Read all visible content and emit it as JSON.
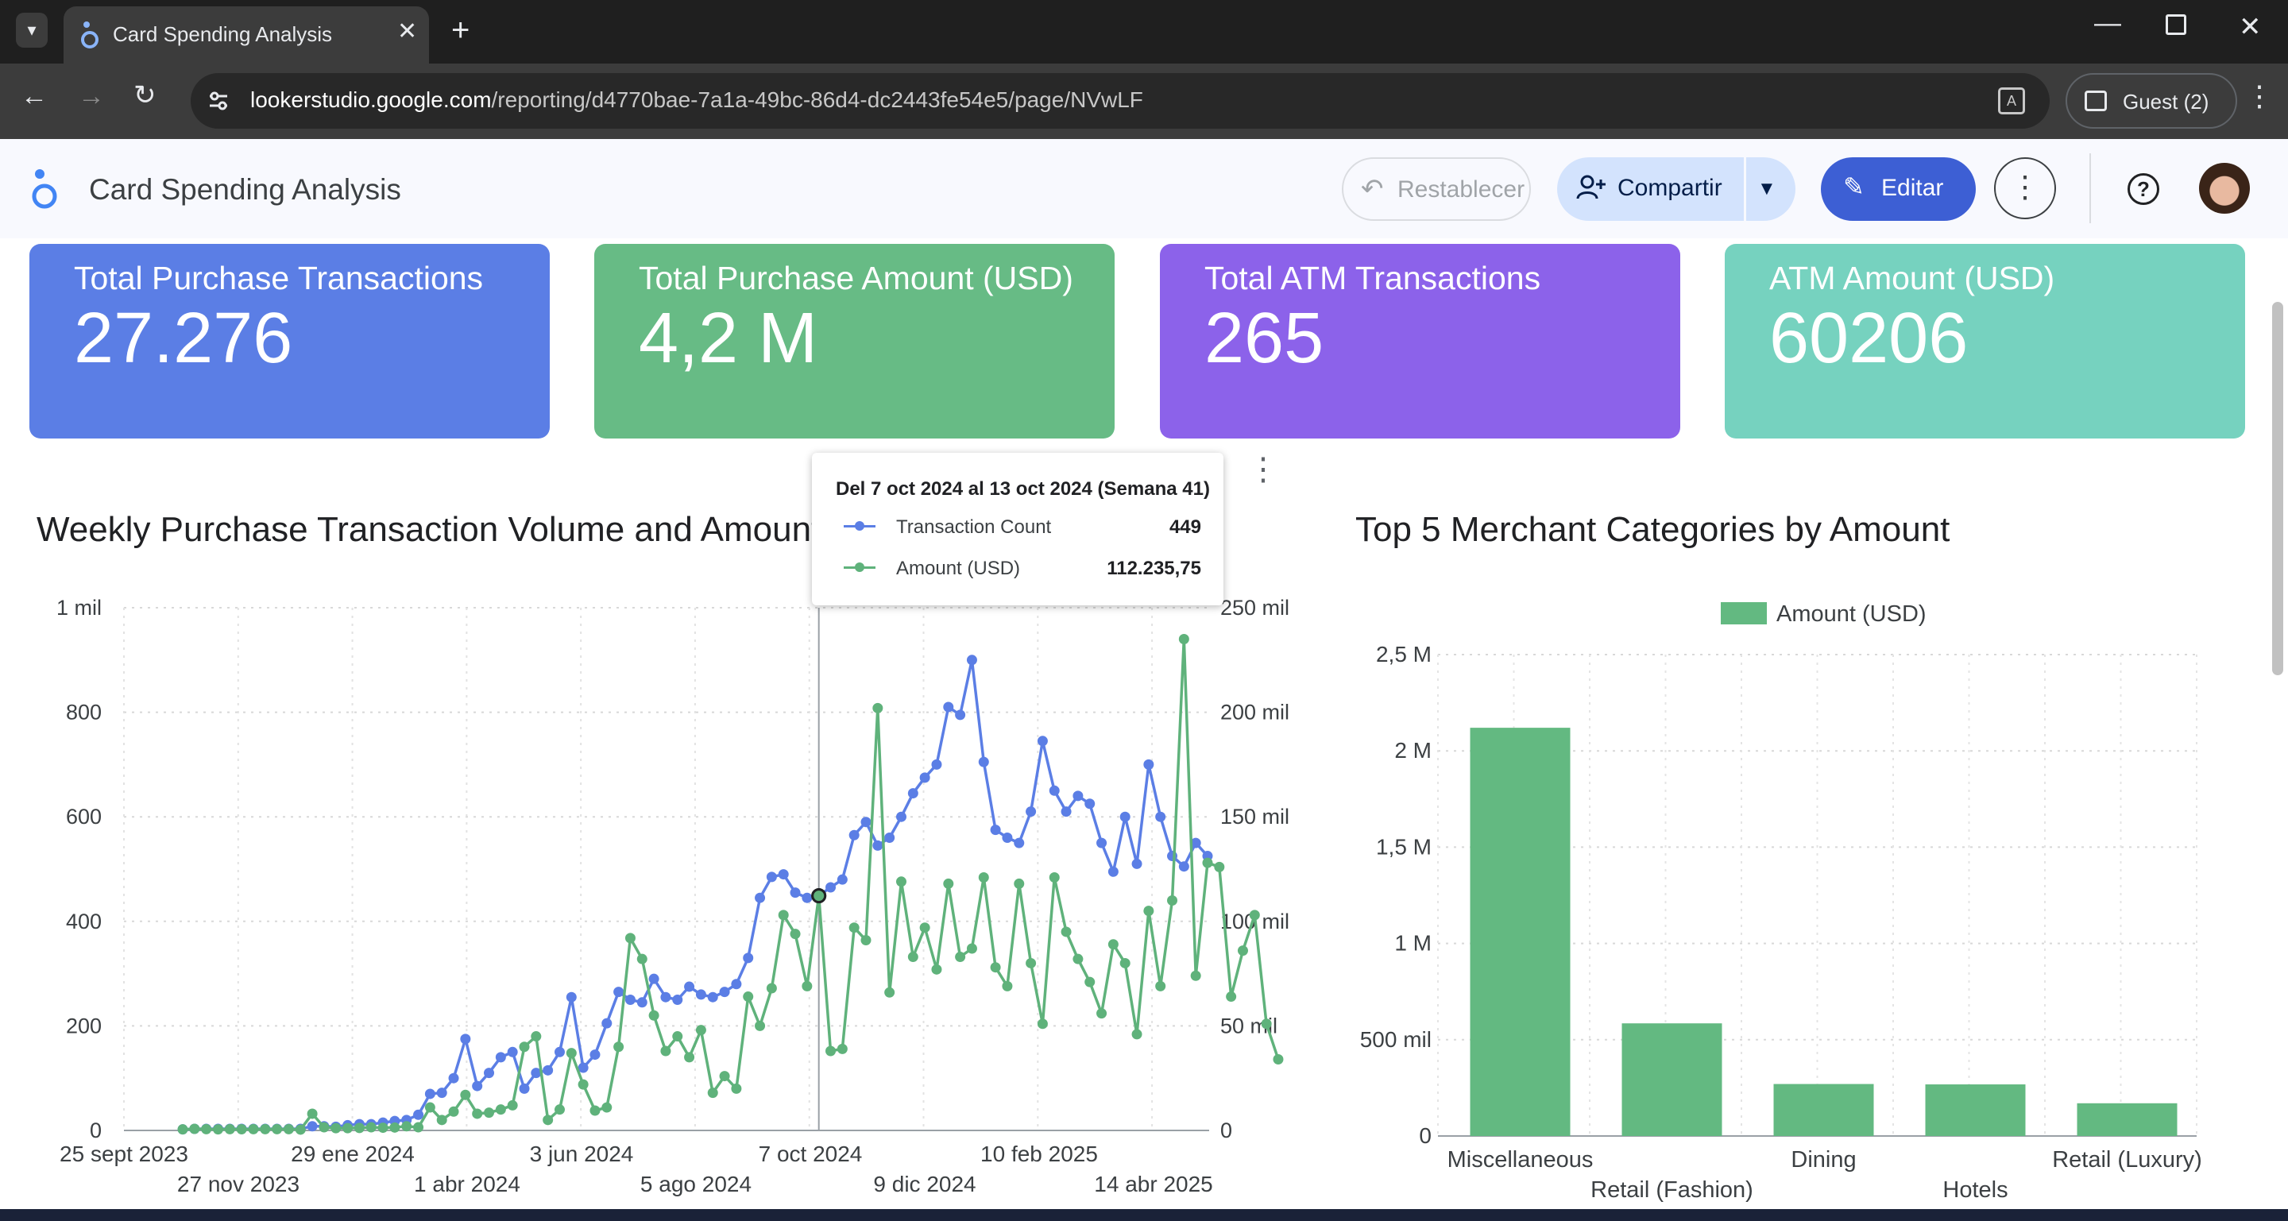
{
  "browser": {
    "tab_title": "Card Spending Analysis",
    "url_host": "lookerstudio.google.com",
    "url_path": "/reporting/d4770bae-7a1a-49bc-86d4-dc2443fe54e5/page/NVwLF",
    "profile_label": "Guest (2)"
  },
  "header": {
    "report_title": "Card Spending Analysis",
    "reset_label": "Restablecer",
    "share_label": "Compartir",
    "edit_label": "Editar"
  },
  "kpis": [
    {
      "title": "Total Purchase Transactions",
      "value": "27.276",
      "color": "#5b7ee5"
    },
    {
      "title": "Total Purchase Amount (USD)",
      "value": "4,2 M",
      "color": "#67bb85"
    },
    {
      "title": "Total ATM Transactions",
      "value": "265",
      "color": "#8c62ea"
    },
    {
      "title": "ATM Amount (USD)",
      "value": "60206",
      "color": "#76d2bf"
    }
  ],
  "tooltip": {
    "title": "Del 7 oct 2024 al 13 oct 2024 (Semana 41)",
    "rows": [
      {
        "label": "Transaction Count",
        "value": "449",
        "color": "#5b7ee5"
      },
      {
        "label": "Amount (USD)",
        "value": "112.235,75",
        "color": "#5fb27b"
      }
    ]
  },
  "chart_data": [
    {
      "type": "line",
      "title": "Weekly Purchase Transaction Volume and Amount",
      "y_ticks_left": [
        "0",
        "200",
        "400",
        "600",
        "800",
        "1 mil"
      ],
      "y_ticks_right": [
        "0",
        "50 mil",
        "100 mil",
        "150 mil",
        "200 mil",
        "250 mil"
      ],
      "ylim_left": [
        0,
        1000
      ],
      "ylim_right": [
        0,
        250000
      ],
      "x_ticks_top": [
        "25 sept 2023",
        "29 ene 2024",
        "3 jun 2024",
        "7 oct 2024",
        "10 feb 2025"
      ],
      "x_ticks_bottom": [
        "27 nov 2023",
        "1 abr 2024",
        "5 ago 2024",
        "9 dic 2024",
        "14 abr 2025"
      ],
      "grid": true,
      "highlighted_week_index": 54,
      "series": [
        {
          "name": "Transaction Count",
          "axis": "left",
          "color": "#5b7ee5",
          "values": [
            2,
            3,
            3,
            3,
            3,
            3,
            3,
            3,
            3,
            3,
            3,
            8,
            8,
            7,
            10,
            12,
            12,
            15,
            18,
            20,
            30,
            70,
            72,
            100,
            175,
            85,
            110,
            140,
            150,
            80,
            110,
            115,
            150,
            255,
            120,
            145,
            205,
            265,
            250,
            245,
            290,
            255,
            250,
            275,
            260,
            255,
            265,
            280,
            330,
            445,
            485,
            490,
            455,
            445,
            449,
            465,
            480,
            565,
            590,
            545,
            560,
            600,
            645,
            675,
            700,
            810,
            795,
            900,
            705,
            575,
            560,
            550,
            610,
            745,
            650,
            610,
            640,
            625,
            550,
            495,
            600,
            510,
            700,
            600,
            525,
            505,
            550,
            525
          ]
        },
        {
          "name": "Amount (USD)",
          "axis": "right",
          "color": "#5fb27b",
          "values": [
            500,
            750,
            600,
            500,
            600,
            550,
            600,
            600,
            600,
            600,
            400,
            8000,
            1500,
            1100,
            1100,
            1200,
            1500,
            1300,
            1400,
            2000,
            1500,
            11000,
            5000,
            9000,
            17000,
            8000,
            8500,
            10000,
            12000,
            40000,
            45000,
            5000,
            10000,
            37000,
            22000,
            9500,
            11000,
            40000,
            92000,
            82000,
            55000,
            38000,
            45000,
            35000,
            48000,
            18000,
            26000,
            20000,
            64000,
            50000,
            68000,
            103000,
            94000,
            69000,
            112235,
            38000,
            39000,
            97000,
            91000,
            202000,
            66000,
            119000,
            83000,
            97000,
            77000,
            118000,
            83000,
            87000,
            121000,
            78000,
            69000,
            118000,
            80000,
            51000,
            121000,
            95000,
            82000,
            71000,
            56000,
            89000,
            80000,
            46000,
            105000,
            69000,
            110000,
            235000,
            74000,
            128000,
            126000,
            64000,
            86000,
            103000,
            51000,
            34000
          ]
        }
      ]
    },
    {
      "type": "bar",
      "title": "Top 5 Merchant Categories by Amount",
      "legend": "Amount (USD)",
      "legend_position": "top",
      "categories": [
        "Miscellaneous",
        "Retail (Fashion)",
        "Dining",
        "Hotels",
        "Retail (Luxury)"
      ],
      "values": [
        2120000,
        585000,
        270000,
        268000,
        170000
      ],
      "y_ticks": [
        "0",
        "500 mil",
        "1 M",
        "1,5 M",
        "2 M",
        "2,5 M"
      ],
      "ylim": [
        0,
        2500000
      ],
      "color": "#63b981"
    }
  ]
}
